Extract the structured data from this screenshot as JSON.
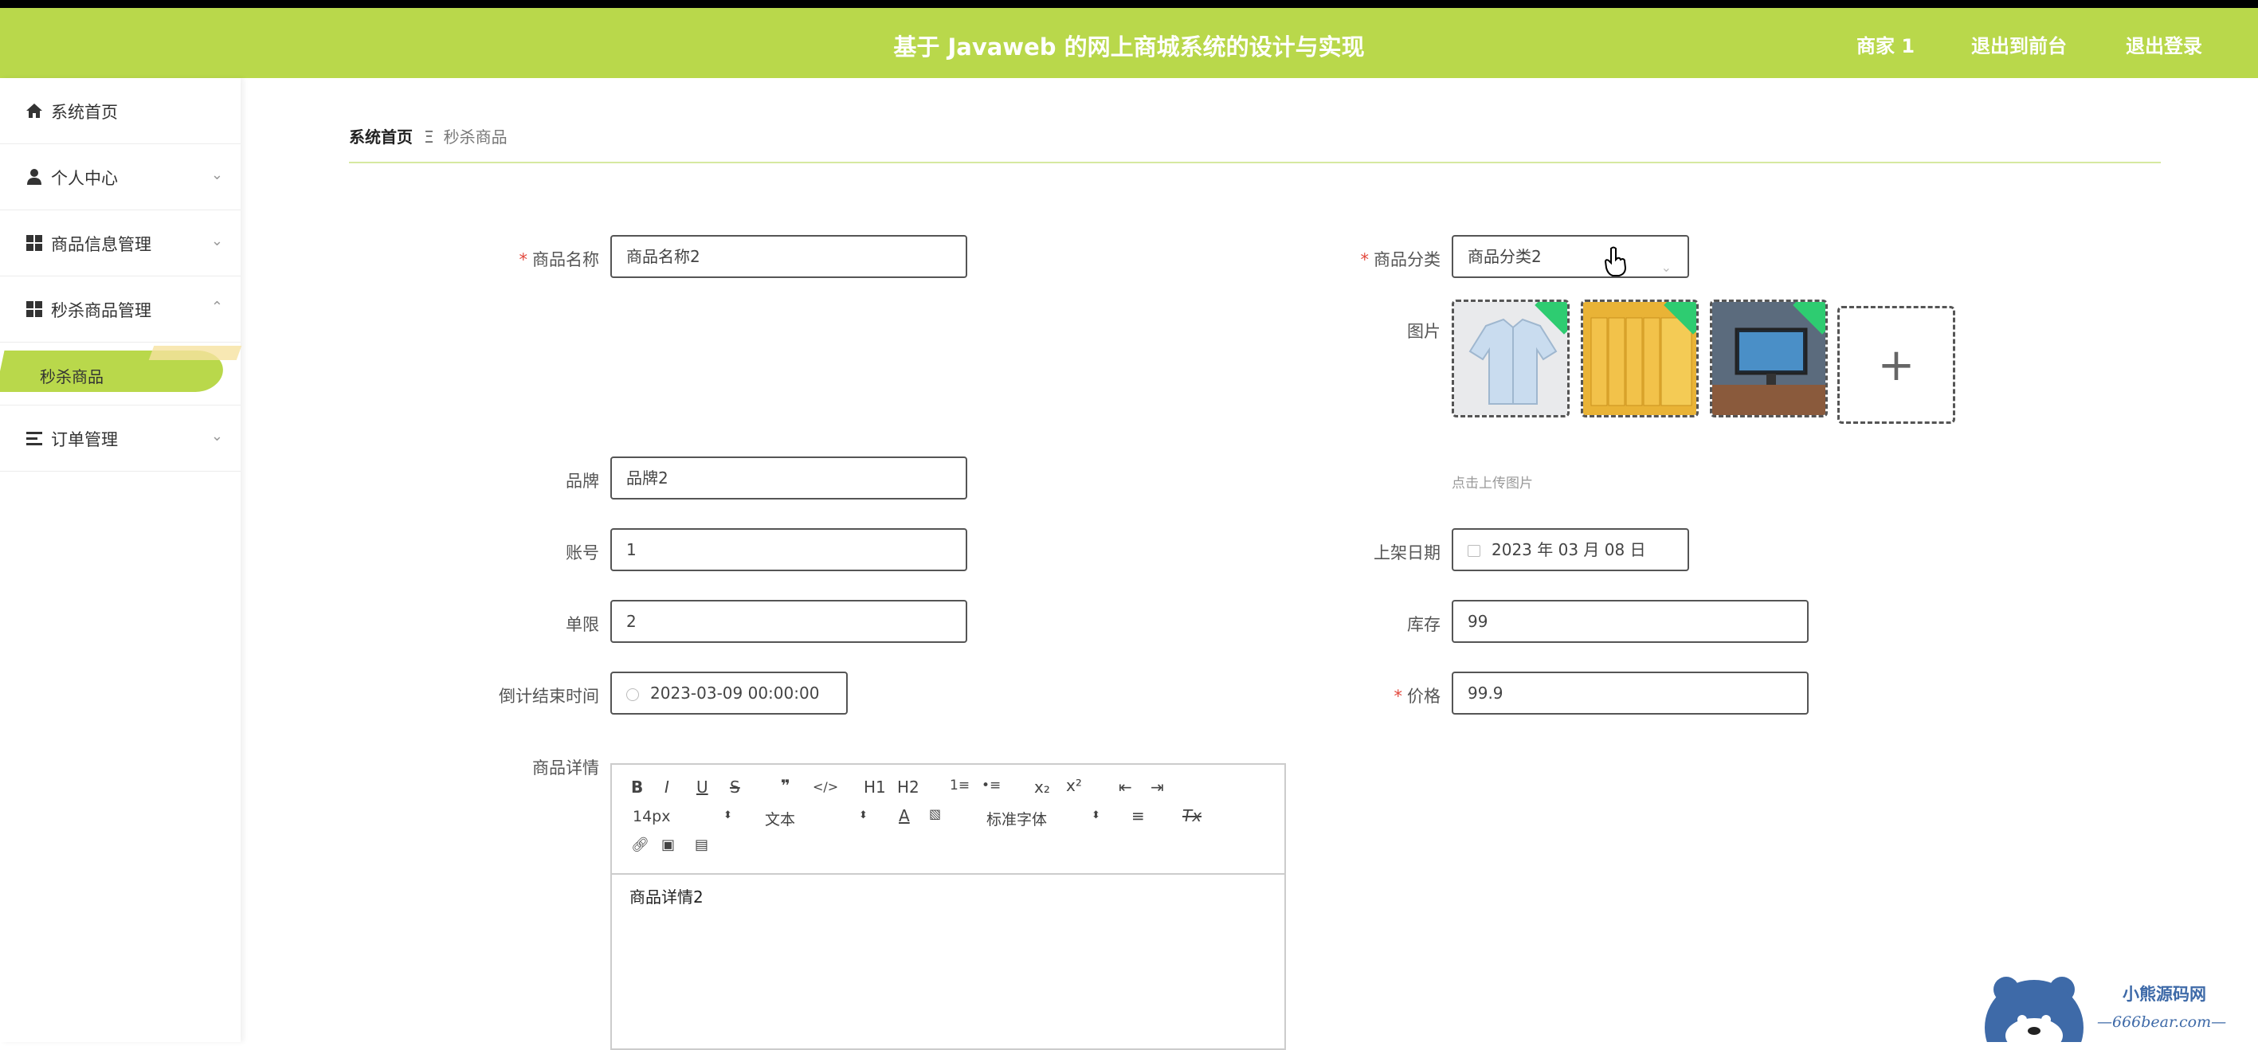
{
  "header": {
    "title": "基于 Javaweb 的网上商城系统的设计与实现",
    "nav": [
      "商家 1",
      "退出到前台",
      "退出登录"
    ]
  },
  "sidebar": {
    "items": [
      {
        "label": "系统首页",
        "icon": "home-icon"
      },
      {
        "label": "个人中心",
        "icon": "user-icon"
      },
      {
        "label": "商品信息管理",
        "icon": "grid-icon"
      },
      {
        "label": "秒杀商品管理",
        "icon": "grid-icon"
      },
      {
        "label": "订单管理",
        "icon": "list-icon"
      }
    ],
    "sub_item": "秒杀商品"
  },
  "breadcrumb": {
    "home": "系统首页",
    "sep": "Ξ",
    "current": "秒杀商品"
  },
  "form": {
    "name_label": "商品名称",
    "name_value": "商品名称2",
    "category_label": "商品分类",
    "category_value": "商品分类2",
    "image_label": "图片",
    "upload_hint": "点击上传图片",
    "brand_label": "品牌",
    "brand_value": "品牌2",
    "account_label": "账号",
    "account_value": "1",
    "shelf_date_label": "上架日期",
    "shelf_date_value": "2023 年 03 月 08 日",
    "limit_label": "单限",
    "limit_value": "2",
    "stock_label": "库存",
    "stock_value": "99",
    "countdown_label": "倒计结束时间",
    "countdown_value": "2023-03-09 00:00:00",
    "price_label": "价格",
    "price_value": "99.9",
    "detail_label": "商品详情",
    "detail_value": "商品详情2"
  },
  "editor_toolbar": {
    "row1": [
      "B",
      "I",
      "U",
      "S",
      "❞",
      "</>",
      "H1",
      "H2",
      "1≡",
      "•≡",
      "x₂",
      "x²",
      "⇤",
      "⇥"
    ],
    "font_size": "14px",
    "text_type": "文本",
    "font_family": "标准字体",
    "clear": "Tx"
  },
  "watermark": {
    "line1": "小熊源码网",
    "line2": "—666bear.com—"
  },
  "colors": {
    "accent": "#b9d84b",
    "required": "#e2483d",
    "badge": "#2ecc71"
  }
}
